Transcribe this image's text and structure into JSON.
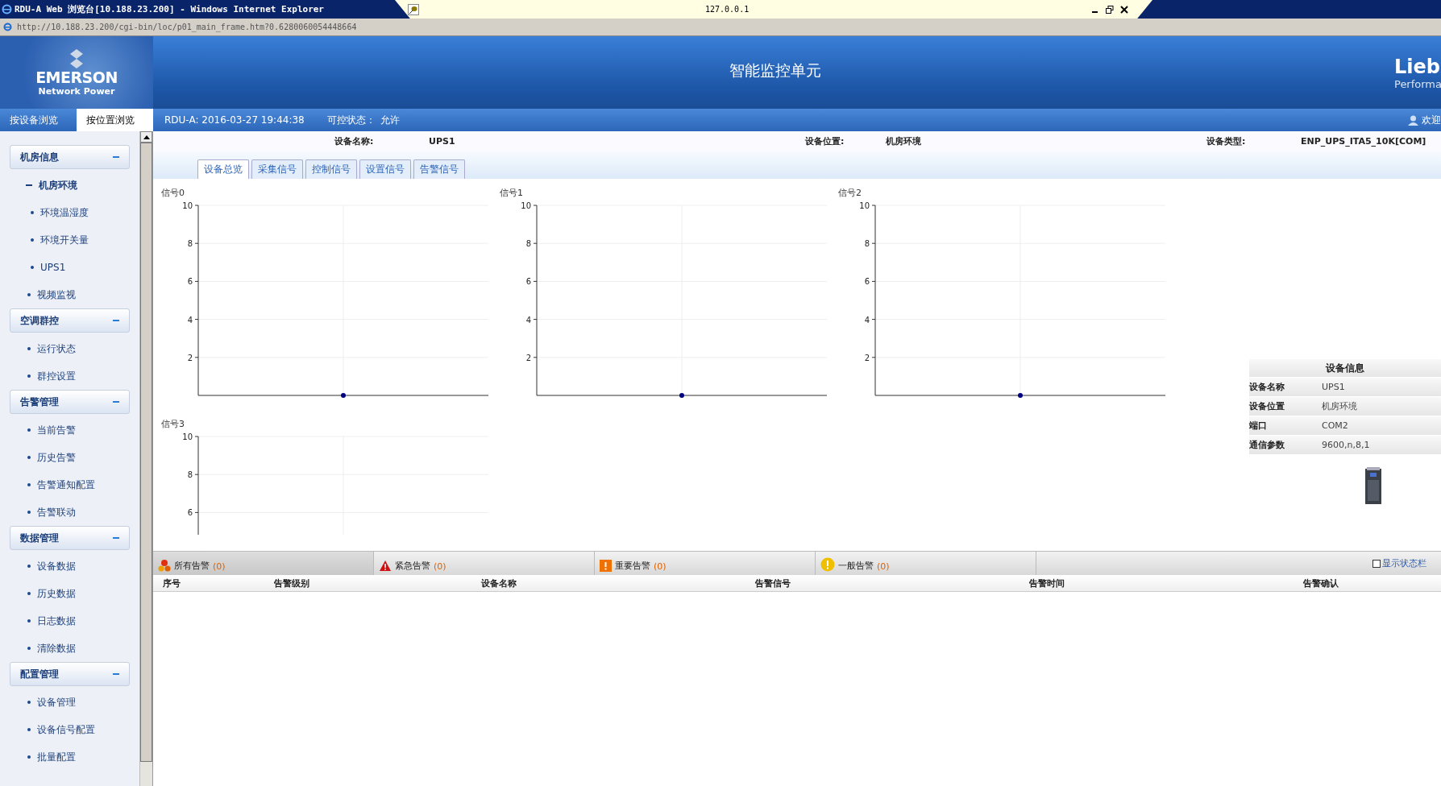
{
  "window": {
    "title": "RDU-A Web 浏览台[10.188.23.200] - Windows Internet Explorer",
    "tab_title": "127.0.0.1"
  },
  "address_bar": {
    "url": "http://10.188.23.200/cgi-bin/loc/p01_main_frame.htm?0.6280060054448664"
  },
  "header": {
    "logo": "EMERSON",
    "logo_sub": "Network Power",
    "title": "智能监控单元",
    "right_logo": "Lieb",
    "right_logo_sub": "Performa"
  },
  "nav": {
    "tabs": [
      {
        "label": "按设备浏览",
        "selected": false
      },
      {
        "label": "按位置浏览",
        "selected": true
      }
    ],
    "timestamp": "RDU-A: 2016-03-27 19:44:38",
    "control_label": "可控状态：",
    "control_value": "允许",
    "welcome": "欢迎"
  },
  "sidebar": {
    "groups": [
      {
        "title": "机房信息",
        "expanded": true,
        "items": [
          {
            "label": "机房环境",
            "expanded": true,
            "children": [
              {
                "label": "环境温湿度"
              },
              {
                "label": "环境开关量"
              },
              {
                "label": "UPS1"
              }
            ]
          },
          {
            "label": "视频监视"
          }
        ]
      },
      {
        "title": "空调群控",
        "expanded": true,
        "items": [
          {
            "label": "运行状态"
          },
          {
            "label": "群控设置"
          }
        ]
      },
      {
        "title": "告警管理",
        "expanded": true,
        "items": [
          {
            "label": "当前告警"
          },
          {
            "label": "历史告警"
          },
          {
            "label": "告警通知配置"
          },
          {
            "label": "告警联动"
          }
        ]
      },
      {
        "title": "数据管理",
        "expanded": true,
        "items": [
          {
            "label": "设备数据"
          },
          {
            "label": "历史数据"
          },
          {
            "label": "日志数据"
          },
          {
            "label": "清除数据"
          }
        ]
      },
      {
        "title": "配置管理",
        "expanded": true,
        "items": [
          {
            "label": "设备管理"
          },
          {
            "label": "设备信号配置"
          },
          {
            "label": "批量配置"
          }
        ]
      }
    ]
  },
  "device": {
    "fields": [
      {
        "label": "设备名称:",
        "value": "UPS1"
      },
      {
        "label": "设备位置:",
        "value": "机房环境"
      },
      {
        "label": "设备类型:",
        "value": "ENP_UPS_ITA5_10K[COM]"
      }
    ]
  },
  "device_tabs": [
    {
      "label": "设备总览",
      "selected": true
    },
    {
      "label": "采集信号",
      "selected": false
    },
    {
      "label": "控制信号",
      "selected": false
    },
    {
      "label": "设置信号",
      "selected": false
    },
    {
      "label": "告警信号",
      "selected": false
    }
  ],
  "charts": [
    {
      "chart_data": {
        "type": "line",
        "title": "信号0",
        "grid": true,
        "categories": [
          null
        ],
        "ylim": [
          0,
          10
        ],
        "yticks": [
          2,
          4,
          6,
          8,
          10
        ],
        "series": [
          {
            "color": "#000080",
            "marker": true,
            "values": [
              0
            ]
          }
        ]
      }
    },
    {
      "chart_data": {
        "type": "line",
        "title": "信号1",
        "grid": true,
        "categories": [
          null
        ],
        "ylim": [
          0,
          10
        ],
        "yticks": [
          2,
          4,
          6,
          8,
          10
        ],
        "series": [
          {
            "color": "#000080",
            "marker": true,
            "values": [
              0
            ]
          }
        ]
      }
    },
    {
      "chart_data": {
        "type": "line",
        "title": "信号2",
        "grid": true,
        "categories": [
          null
        ],
        "ylim": [
          0,
          10
        ],
        "yticks": [
          2,
          4,
          6,
          8,
          10
        ],
        "series": [
          {
            "color": "#000080",
            "marker": true,
            "values": [
              0
            ]
          }
        ]
      }
    },
    {
      "chart_data": {
        "type": "line",
        "title": "信号3",
        "grid": true,
        "categories": [
          null
        ],
        "ylim": [
          0,
          10
        ],
        "yticks": [
          6,
          8,
          10
        ]
      }
    }
  ],
  "device_info": {
    "title": "设备信息",
    "rows": [
      {
        "label": "设备名称",
        "value": "UPS1"
      },
      {
        "label": "设备位置",
        "value": "机房环境"
      },
      {
        "label": "端口",
        "value": "COM2"
      },
      {
        "label": "通信参数",
        "value": "9600,n,8,1"
      }
    ]
  },
  "alarm_tabs": [
    {
      "kind": "all",
      "label": "所有告警",
      "count": "(0)",
      "selected": true
    },
    {
      "kind": "critical",
      "label": "紧急告警",
      "count": "(0)",
      "selected": false
    },
    {
      "kind": "major",
      "label": "重要告警",
      "count": "(0)",
      "selected": false
    },
    {
      "kind": "minor",
      "label": "一般告警",
      "count": "(0)",
      "selected": false
    }
  ],
  "status_toggle": {
    "label": "显示状态栏",
    "checked": false
  },
  "alarm_table": {
    "columns": [
      "序号",
      "告警级别",
      "设备名称",
      "告警信号",
      "告警时间",
      "告警确认"
    ]
  }
}
